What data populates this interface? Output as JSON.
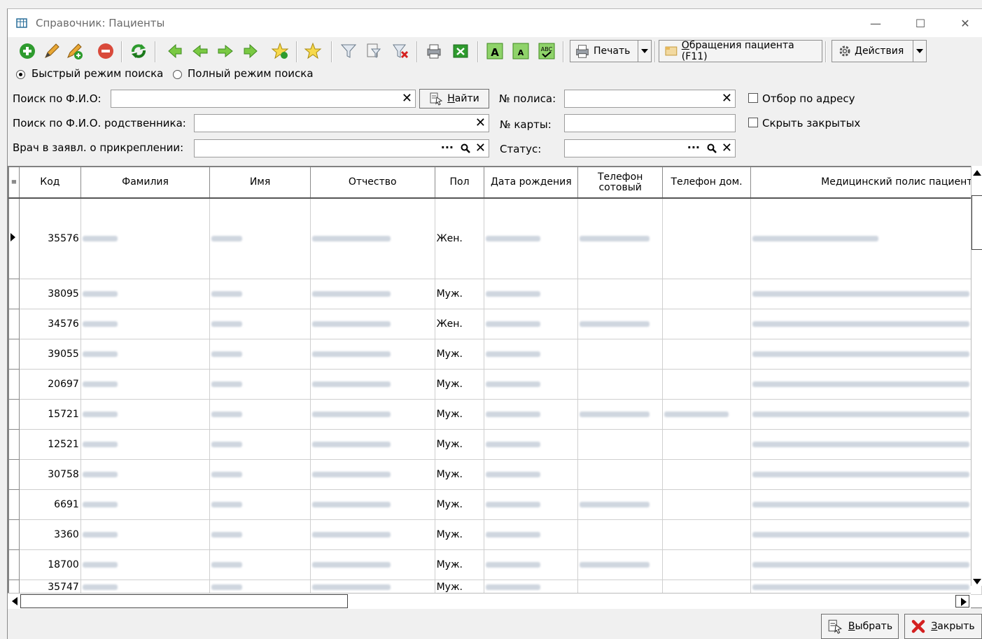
{
  "window": {
    "title": "Справочник: Пациенты",
    "minimize": "—",
    "maximize": "☐",
    "close": "✕"
  },
  "toolbar": {
    "print_label": "Печать",
    "visits_label": "Обращения пациента (F11)",
    "actions_label": "Действия"
  },
  "search_mode": {
    "quick_label": "Быстрый режим поиска",
    "full_label": "Полный режим поиска",
    "selected": "quick"
  },
  "search": {
    "fio_label": "Поиск по Ф.И.О:",
    "fio_value": "",
    "find_label": "Найти",
    "relative_label": "Поиск по Ф.И.О. родственника:",
    "relative_value": "",
    "doctor_label": "Врач в заявл. о прикреплении:",
    "doctor_value": "",
    "policy_label": "№ полиса:",
    "policy_value": "",
    "card_label": "№ карты:",
    "card_value": "",
    "status_label": "Статус:",
    "status_value": "",
    "address_filter_label": "Отбор по адресу",
    "hide_closed_label": "Скрыть закрытых"
  },
  "grid": {
    "columns": [
      "Код",
      "Фамилия",
      "Имя",
      "Отчество",
      "Пол",
      "Дата рождения",
      "Телефон сотовый",
      "Телефон дом.",
      "Медицинский полис пациента"
    ],
    "rows": [
      {
        "code": "35576",
        "sex": "Жен."
      },
      {
        "code": "38095",
        "sex": "Муж."
      },
      {
        "code": "34576",
        "sex": "Жен."
      },
      {
        "code": "39055",
        "sex": "Муж."
      },
      {
        "code": "20697",
        "sex": "Муж."
      },
      {
        "code": "15721",
        "sex": "Муж."
      },
      {
        "code": "12521",
        "sex": "Муж."
      },
      {
        "code": "30758",
        "sex": "Муж."
      },
      {
        "code": "6691",
        "sex": "Муж."
      },
      {
        "code": "3360",
        "sex": "Муж."
      },
      {
        "code": "18700",
        "sex": "Муж."
      },
      {
        "code": "35747",
        "sex": "Муж."
      }
    ]
  },
  "footer": {
    "select_label": "Выбрать",
    "close_label": "Закрыть"
  },
  "colors": {
    "green": "#2e9b2e",
    "red": "#d42020",
    "grid_line": "#cfcfcf"
  }
}
